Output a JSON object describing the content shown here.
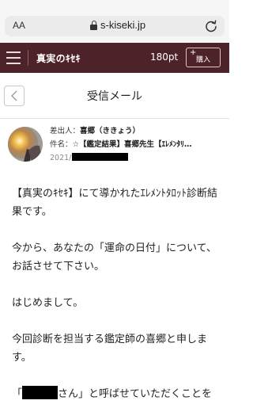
{
  "browser": {
    "aa_label": "AA",
    "url": "s-kiseki.jp"
  },
  "header": {
    "brand": "真実のｷｾｷ",
    "points": "180pt",
    "buy_plus": "+",
    "buy_label": "購入"
  },
  "page": {
    "title": "受信メール"
  },
  "message": {
    "sender_label": "差出人：",
    "sender": "喜郷（ききょう）",
    "subject_label": "件名：",
    "subject": "☆【鑑定結果】喜郷先生【ｴﾚﾒﾝﾀﾘ…",
    "date_prefix": "2021/",
    "body": {
      "p1": "【真実のｷｾｷ】にて導かれたｴﾚﾒﾝﾄﾀﾛｯﾄ診断結果です。",
      "p2": "今から、あなたの「運命の日付」について、お話させて下さい。",
      "p3": "はじめまして。",
      "p4": "今回診断を担当する鑑定師の喜郷と申します。",
      "p5_open": "「",
      "p5_rest": "さん」と呼ばせていただくことを"
    }
  }
}
